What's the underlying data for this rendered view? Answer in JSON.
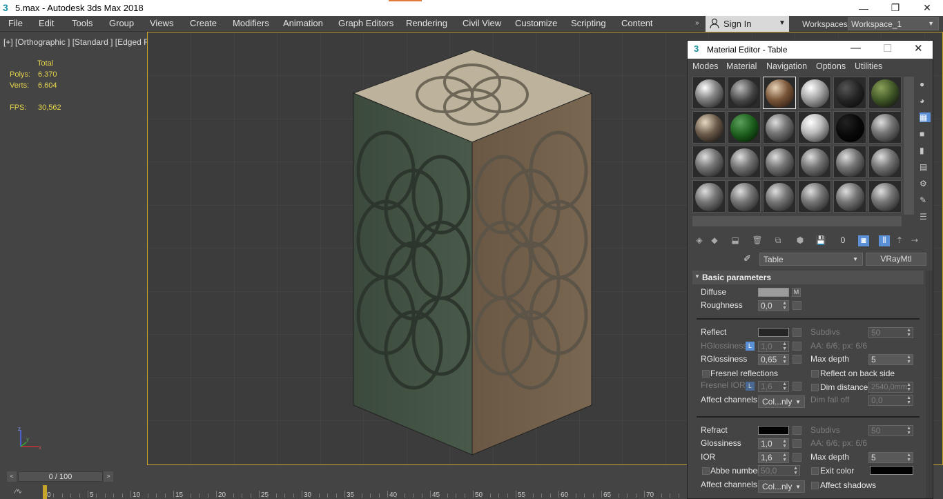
{
  "window": {
    "title": "5.max - Autodesk 3ds Max 2018",
    "app_icon": "3",
    "minimize": "—",
    "maximize": "❐",
    "close": "✕"
  },
  "menubar": {
    "items": [
      "File",
      "Edit",
      "Tools",
      "Group",
      "Views",
      "Create",
      "Modifiers",
      "Animation",
      "Graph Editors",
      "Rendering",
      "Civil View",
      "Customize",
      "Scripting",
      "Content"
    ],
    "overflow": "»"
  },
  "signin": {
    "label": "Sign In"
  },
  "workspaces": {
    "label": "Workspaces:",
    "value": "Workspace_1"
  },
  "viewport": {
    "label": "[+] [Orthographic ] [Standard ] [Edged Faces ]",
    "stats": {
      "total_header": "Total",
      "polys_label": "Polys:",
      "polys_value": "6.370",
      "verts_label": "Verts:",
      "verts_value": "6.604",
      "fps_label": "FPS:",
      "fps_value": "30,562"
    },
    "axis": {
      "z": "z",
      "x": "x",
      "y": "y"
    }
  },
  "timeline": {
    "position": "0 / 100",
    "prev": "<",
    "next": ">",
    "ticks": [
      "0",
      "5",
      "10",
      "15",
      "20",
      "25",
      "30",
      "35",
      "40",
      "45",
      "50",
      "55",
      "60",
      "65",
      "70"
    ],
    "mini_icon": "⁄∿"
  },
  "material_editor": {
    "title": "Material Editor - Table",
    "icon": "3",
    "menu": [
      "Modes",
      "Material",
      "Navigation",
      "Options",
      "Utilities"
    ],
    "material_name": "Table",
    "material_type": "VRayMtl",
    "rollout_title": "Basic parameters",
    "colors": {
      "diffuse": "#9c9c9c",
      "reflect": "#262626",
      "refract": "#020202",
      "exit": "#020202"
    },
    "params": {
      "diffuse": "Diffuse",
      "diffuse_map": "M",
      "roughness": "Roughness",
      "roughness_val": "0,0",
      "reflect": "Reflect",
      "subdivs": "Subdivs",
      "subdivs_val": "50",
      "hglossiness": "HGlossiness",
      "hglossiness_lock": "L",
      "hglossiness_val": "1,0",
      "aa": "AA: 6/6; px: 6/6",
      "rglossiness": "RGlossiness",
      "rglossiness_val": "0,65",
      "maxdepth": "Max depth",
      "maxdepth_val": "5",
      "fresnel": "Fresnel reflections",
      "reflect_back": "Reflect on back side",
      "fresnel_ior": "Fresnel IOR",
      "fresnel_lock": "L",
      "fresnel_ior_val": "1,6",
      "dim_distance": "Dim distance",
      "dim_distance_val": "2540,0mm",
      "affect_channels": "Affect channels",
      "affect_val": "Col...nly",
      "dim_falloff": "Dim fall off",
      "dim_falloff_val": "0,0",
      "refract": "Refract",
      "subdivs2": "Subdivs",
      "subdivs2_val": "50",
      "glossiness": "Glossiness",
      "glossiness_val": "1,0",
      "aa2": "AA: 6/6; px: 6/6",
      "ior": "IOR",
      "ior_val": "1,6",
      "maxdepth2": "Max depth",
      "maxdepth2_val": "5",
      "abbe": "Abbe number",
      "abbe_val": "50,0",
      "exit_color": "Exit color",
      "affect_channels2": "Affect channels",
      "affect2_val": "Col...nly",
      "affect_shadows": "Affect shadows"
    }
  }
}
